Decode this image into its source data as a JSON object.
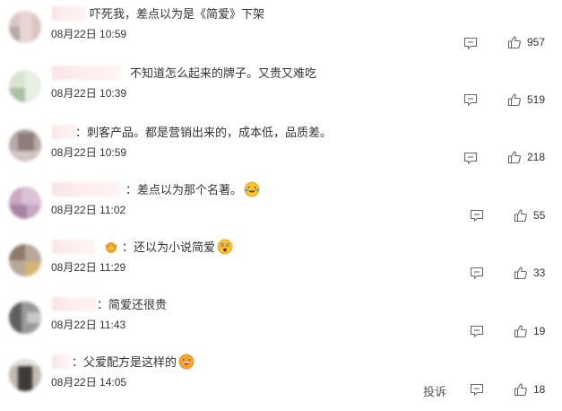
{
  "comments": [
    {
      "text": "吓死我，差点以为是《简爱》下架",
      "time": "08月22日 10:59",
      "likes": "957"
    },
    {
      "text": "不知道怎么起来的牌子。又贵又难吃",
      "time": "08月22日 10:39",
      "likes": "519"
    },
    {
      "text": "：刺客产品。都是营销出来的，成本低，品质差。",
      "time": "08月22日 10:59",
      "likes": "218"
    },
    {
      "text": "：差点以为那个名著。",
      "time": "08月22日 11:02",
      "likes": "55",
      "emoji": "laughing-crying-emoji"
    },
    {
      "text": "：还以为小说简爱",
      "time": "08月22日 11:29",
      "likes": "33",
      "emoji": "astonished-emoji",
      "badge": "crown-badge-icon"
    },
    {
      "text": "：简爱还很贵",
      "time": "08月22日 11:43",
      "likes": "19"
    },
    {
      "text": "：父爱配方是这样的",
      "time": "08月22日 14:05",
      "likes": "18",
      "emoji": "grinning-emoji",
      "report": "投诉"
    }
  ],
  "icons": {
    "reply": "comment-icon",
    "like": "thumbs-up-icon"
  },
  "colors": {
    "text": "#333333",
    "icon": "#666666",
    "name_blur": "#fbe4e4"
  }
}
